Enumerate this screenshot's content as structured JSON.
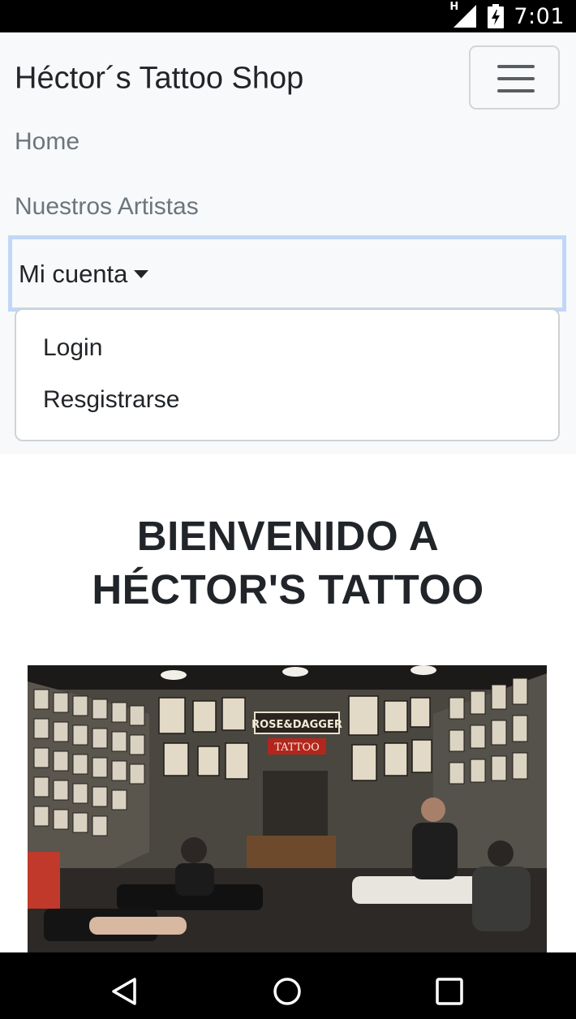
{
  "status_bar": {
    "time": "7:01",
    "network_label": "H"
  },
  "navbar": {
    "brand": "Héctor´s Tattoo Shop",
    "links": {
      "home": "Home",
      "artists": "Nuestros Artistas",
      "account": "Mi cuenta"
    },
    "dropdown": {
      "login": "Login",
      "register": "Resgistrarse"
    }
  },
  "hero": {
    "title_line1": "BIENVENIDO A",
    "title_line2": "HÉCTOR'S TATTOO"
  },
  "photo": {
    "sign_text_1": "ROSE&DAGGER",
    "sign_text_2": "TATTOO"
  },
  "colors": {
    "navbar_bg": "#f8f9fa",
    "focus_ring": "#c2d7f7",
    "link_muted": "#6c757d",
    "text_dark": "#212529"
  }
}
